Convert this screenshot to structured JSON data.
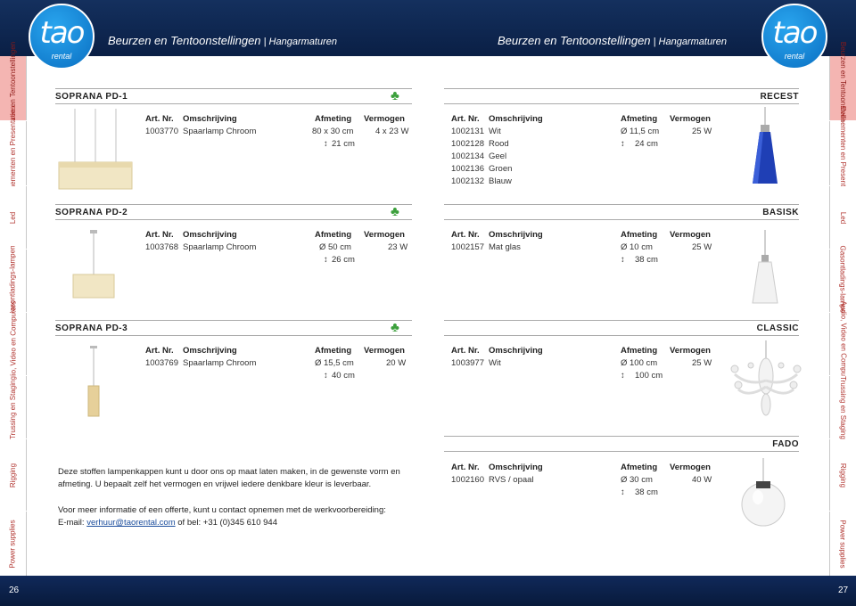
{
  "header": {
    "brand": "tao",
    "brand_sub": "rental",
    "title_main": "Beurzen en Tentoonstellingen",
    "title_sep": " | ",
    "title_sub": "Hangarmaturen"
  },
  "footer": {
    "page_left": "26",
    "page_right": "27"
  },
  "tabs": [
    "Beurzen en Tentoonstellingen",
    "Evenementen en Presentaties",
    "Led",
    "Gasontladings-lampen",
    "Audio, Video en Computers",
    "Trussing en Staging",
    "Rigging",
    "Power supplies"
  ],
  "columns": {
    "art": "Art. Nr.",
    "desc": "Omschrijving",
    "size": "Afmeting",
    "power": "Vermogen"
  },
  "left": {
    "sections": [
      {
        "name": "SOPRANA PD-1",
        "rows": [
          {
            "art": "1003770",
            "desc": "Spaarlamp Chroom",
            "size1": "80 x 30 cm",
            "size2": "21 cm",
            "power": "4 x 23 W"
          }
        ]
      },
      {
        "name": "SOPRANA PD-2",
        "rows": [
          {
            "art": "1003768",
            "desc": "Spaarlamp Chroom",
            "size1": "Ø 50 cm",
            "size2": "26 cm",
            "power": "23 W"
          }
        ]
      },
      {
        "name": "SOPRANA PD-3",
        "rows": [
          {
            "art": "1003769",
            "desc": "Spaarlamp Chroom",
            "size1": "Ø 15,5 cm",
            "size2": "40 cm",
            "power": "20 W"
          }
        ]
      }
    ],
    "info1": "Deze stoffen lampenkappen kunt u door ons op maat laten maken, in de gewenste vorm en afmeting. U bepaalt zelf het vermogen en vrijwel iedere denkbare kleur is leverbaar.",
    "info2": "Voor meer informatie of een offerte, kunt u contact opnemen met de werkvoorbereiding:",
    "email_prefix": "E-mail: ",
    "email": "verhuur@taorental.com",
    "email_suffix": " of bel: +31 (0)345 610 944"
  },
  "right": {
    "sections": [
      {
        "name": "RECEST",
        "rows": [
          {
            "art": "1002131",
            "desc": "Wit",
            "size1": "Ø 11,5 cm",
            "size2": "24 cm",
            "power": "25 W"
          },
          {
            "art": "1002128",
            "desc": "Rood"
          },
          {
            "art": "1002134",
            "desc": "Geel"
          },
          {
            "art": "1002136",
            "desc": "Groen"
          },
          {
            "art": "1002132",
            "desc": "Blauw"
          }
        ]
      },
      {
        "name": "BASISK",
        "rows": [
          {
            "art": "1002157",
            "desc": "Mat glas",
            "size1": "Ø 10 cm",
            "size2": "38 cm",
            "power": "25 W"
          }
        ]
      },
      {
        "name": "CLASSIC",
        "rows": [
          {
            "art": "1003977",
            "desc": "Wit",
            "size1": "Ø 100 cm",
            "size2": "100 cm",
            "power": "25 W"
          }
        ]
      },
      {
        "name": "FADO",
        "rows": [
          {
            "art": "1002160",
            "desc": "RVS / opaal",
            "size1": "Ø 30 cm",
            "size2": "38 cm",
            "power": "40 W"
          }
        ]
      }
    ]
  },
  "colors": {
    "header_bg": "#0d2450",
    "logo": "#1a8ad8",
    "tab_active": "#f4b5b2",
    "tab_text": "#b0322d",
    "clover": "#3ca03c"
  },
  "icons": [
    "clover-icon",
    "height-arrow-icon",
    "diameter-icon"
  ]
}
